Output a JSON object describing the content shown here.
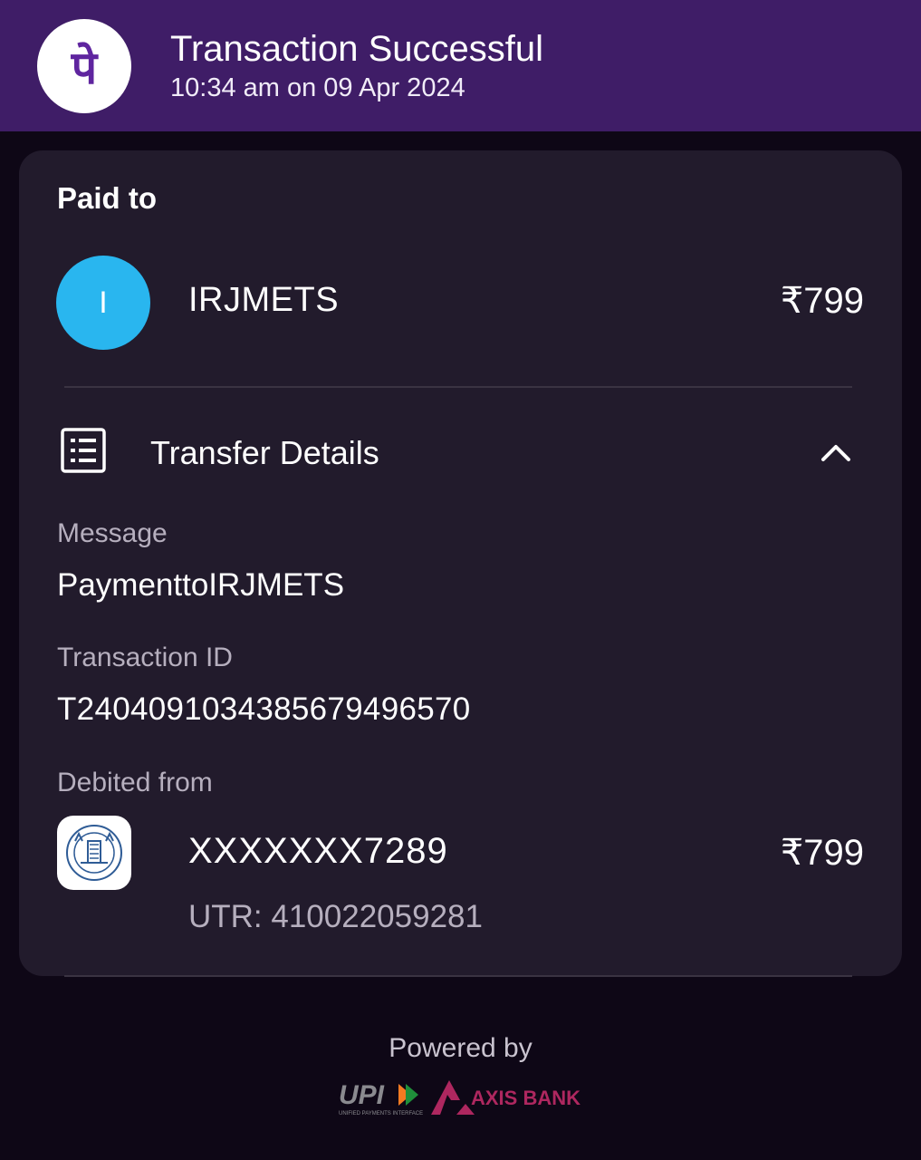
{
  "header": {
    "title": "Transaction Successful",
    "time": "10:34 am on 09 Apr 2024",
    "logo_glyph": "पे",
    "logo_color": "#5f259f",
    "bg_color": "#3f1d67"
  },
  "paid_to": {
    "label": "Paid to",
    "avatar_initial": "I",
    "avatar_color": "#29b6ef",
    "name": "IRJMETS",
    "amount": "₹799"
  },
  "transfer_details": {
    "title": "Transfer Details",
    "icon": "receipt-list-icon",
    "toggle_icon": "chevron-up-icon",
    "message_label": "Message",
    "message_value": "PaymenttoIRJMETS",
    "txn_label": "Transaction ID",
    "txn_value": "T2404091034385679496570",
    "debited_label": "Debited from",
    "account": "XXXXXXX7289",
    "utr": "UTR: 410022059281",
    "debited_amount": "₹799",
    "bank_logo_icon": "bank-seal-icon"
  },
  "footer": {
    "powered_by": "Powered by",
    "upi_logo": "upi-logo",
    "bank_name": "AXIS BANK",
    "axis_color": "#ae275f"
  }
}
